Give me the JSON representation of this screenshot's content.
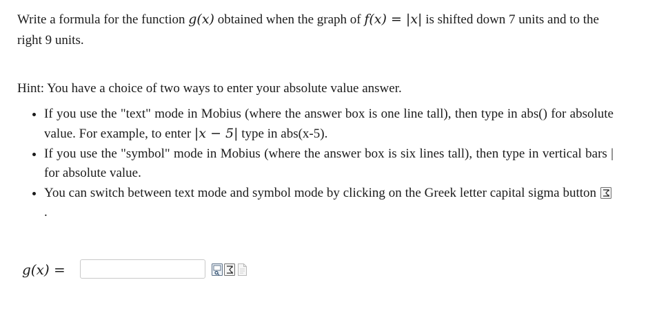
{
  "question": {
    "text_1": "Write a formula for the function ",
    "g_of_x": "g(x)",
    "text_2": " obtained when the graph of ",
    "f_of_x": "f(x) = |x|",
    "text_3": " is shifted down 7 units and to the right 9 units."
  },
  "hint": {
    "intro": "Hint: You have a choice of two ways to enter your absolute value answer.",
    "items": [
      {
        "text_1": "If you use the \"text\" mode in Mobius (where the answer box is one line tall), then type in abs() for absolute value. For example, to enter ",
        "math": "|x − 5|",
        "text_2": " type in abs(x-5)."
      },
      {
        "text_1": "If you use the \"symbol\" mode in Mobius (where the answer box is six lines tall), then type in vertical bars | for absolute value."
      },
      {
        "text_1": "You can switch between text mode and symbol mode by clicking on the Greek letter capital sigma button",
        "text_2": "."
      }
    ]
  },
  "answer": {
    "label": "g(x) =",
    "value": "",
    "placeholder": ""
  },
  "icons": {
    "sigma_button": "sigma-icon",
    "preview_button": "preview-icon",
    "toggle_button": "sigma-icon",
    "help_button": "document-icon"
  }
}
